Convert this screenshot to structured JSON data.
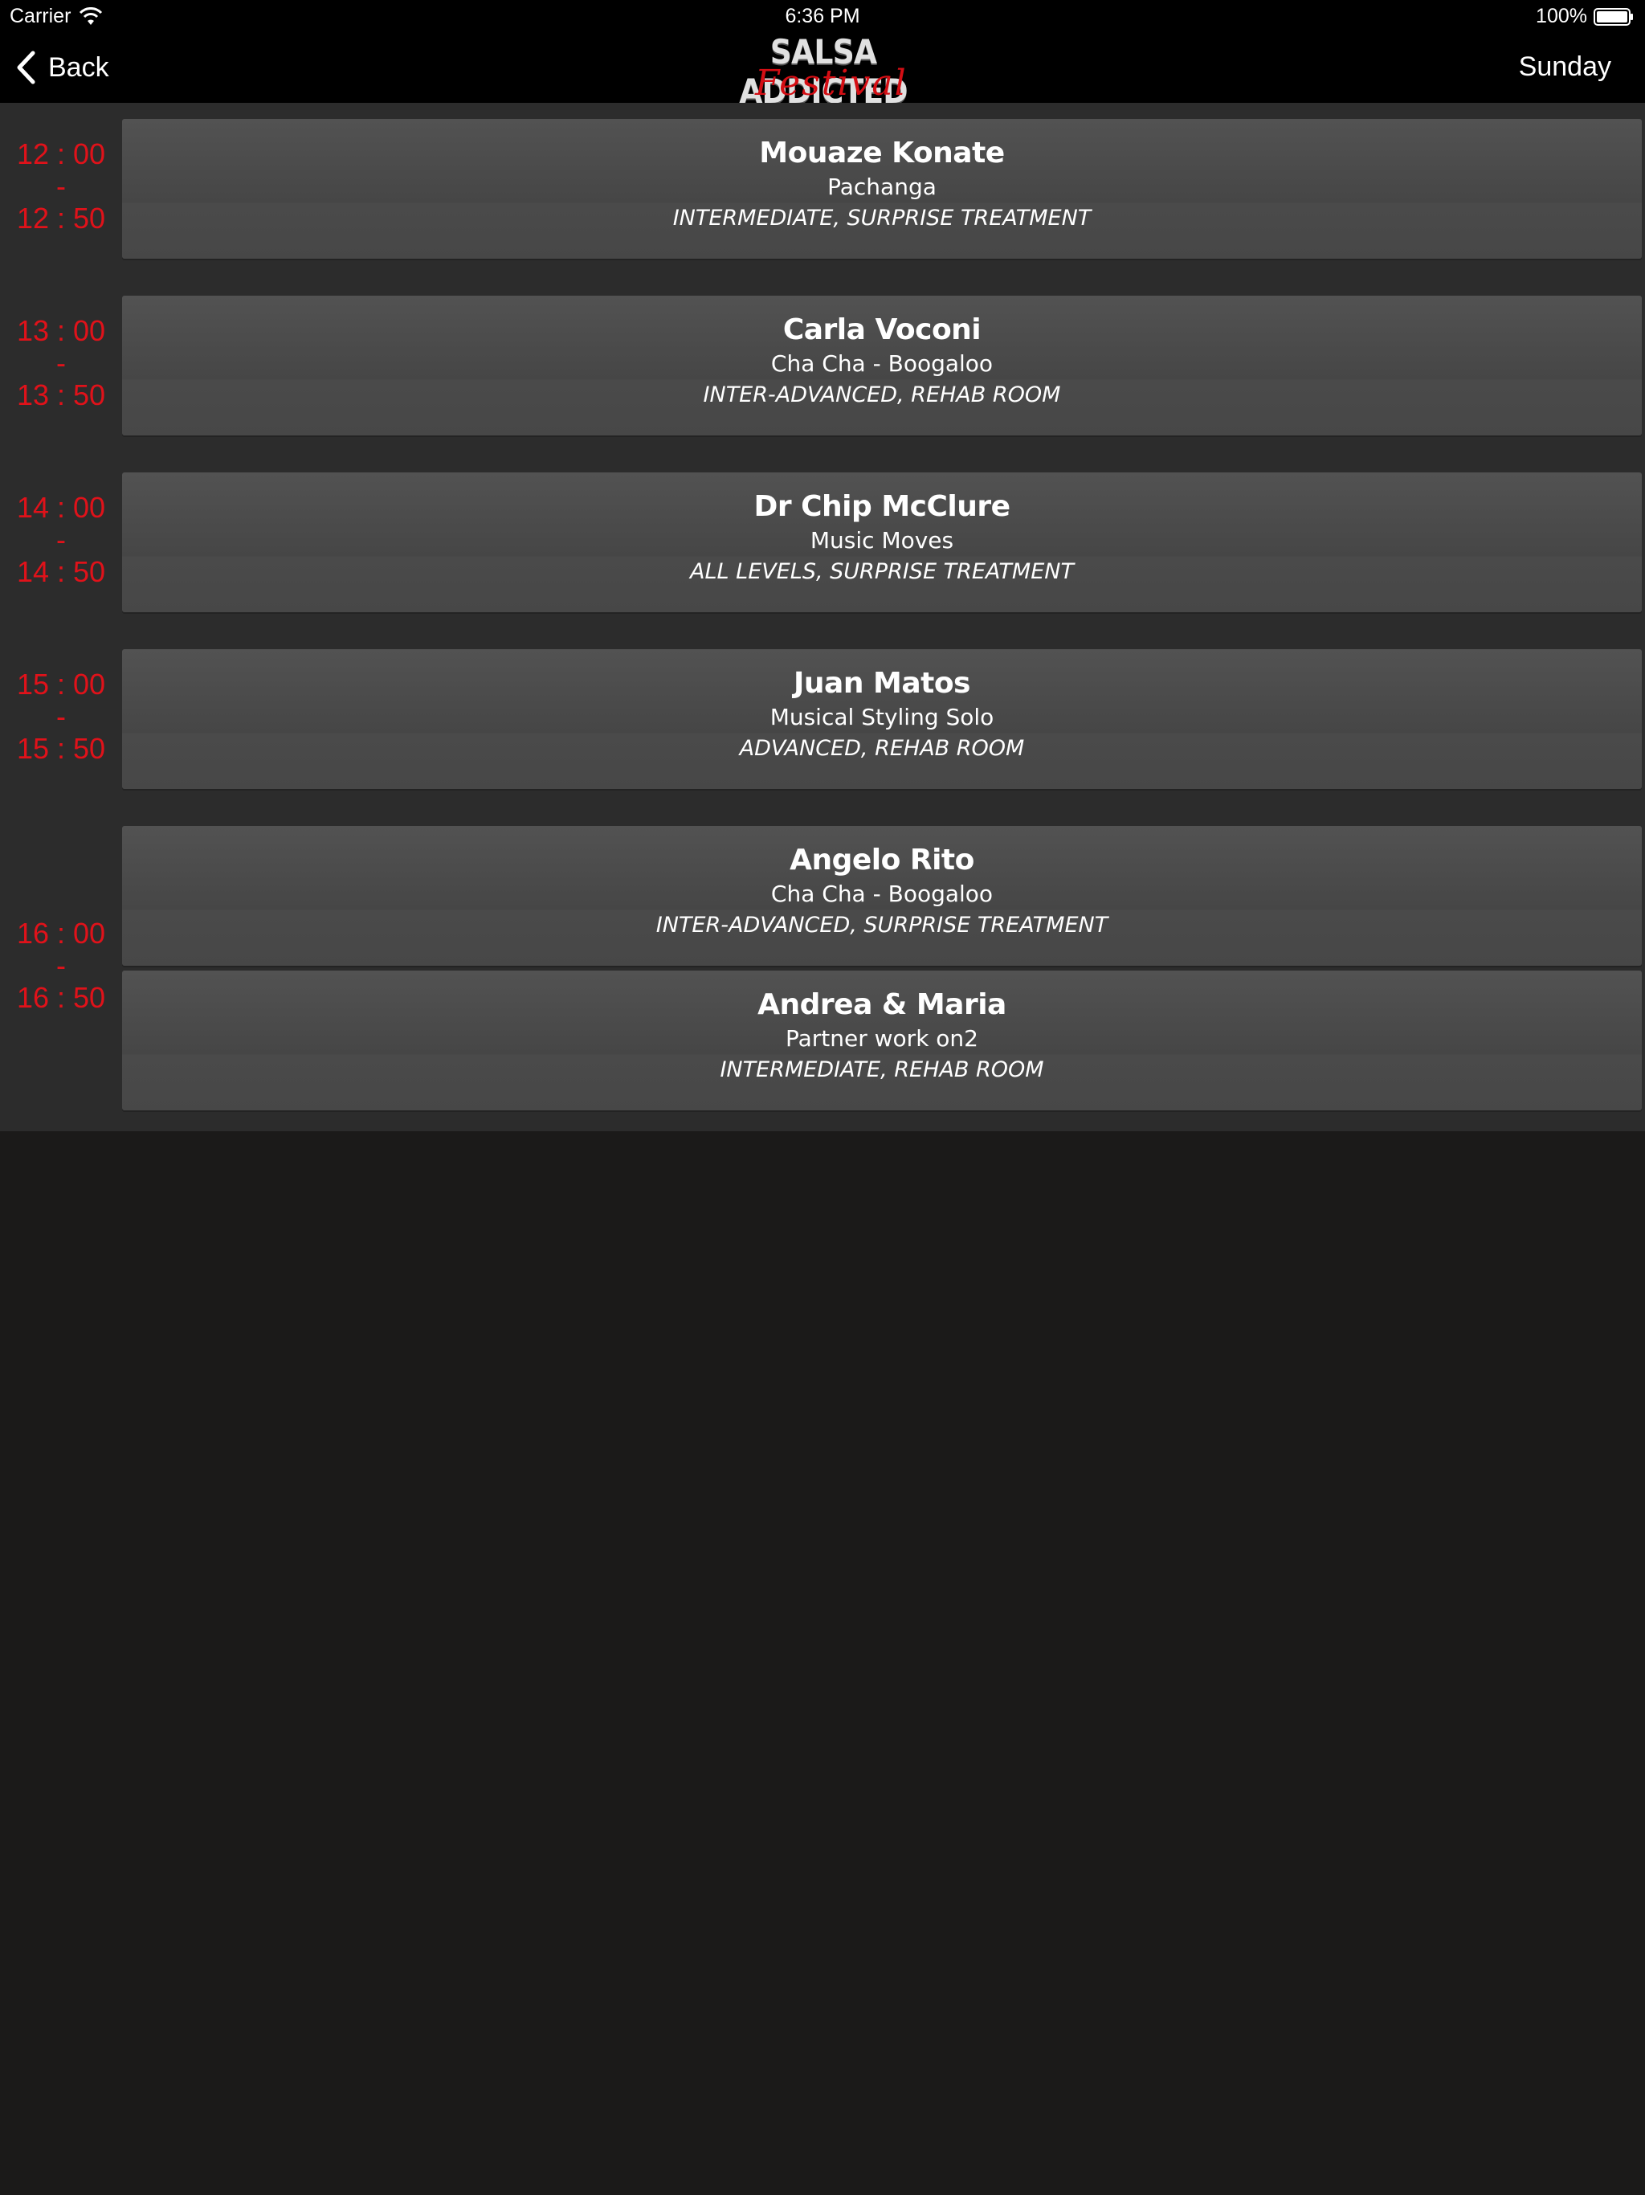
{
  "status_bar": {
    "carrier": "Carrier",
    "time": "6:36 PM",
    "battery": "100%"
  },
  "nav": {
    "back_label": "Back",
    "logo_title": "SALSA ADDICTED",
    "logo_script": "Festival",
    "day": "Sunday"
  },
  "colors": {
    "time_red": "#e0121a",
    "logo_red": "#d40e14",
    "card_bg": "#4c4c4c",
    "list_bg": "#2c2c2c",
    "page_bg": "#1b1a19"
  },
  "slots": [
    {
      "start": "12 : 00",
      "sep": "-",
      "end": "12 : 50"
    },
    {
      "start": "13 : 00",
      "sep": "-",
      "end": "13 : 50"
    },
    {
      "start": "14 : 00",
      "sep": "-",
      "end": "14 : 50"
    },
    {
      "start": "15 : 00",
      "sep": "-",
      "end": "15 : 50"
    },
    {
      "start": "16 : 00",
      "sep": "-",
      "end": "16 : 50"
    }
  ],
  "classes": [
    {
      "name": "Mouaze Konate",
      "style": "Pachanga",
      "level": "INTERMEDIATE, SURPRISE TREATMENT"
    },
    {
      "name": "Carla Voconi",
      "style": "Cha Cha - Boogaloo",
      "level": "INTER-ADVANCED, REHAB ROOM"
    },
    {
      "name": "Dr Chip McClure",
      "style": "Music Moves",
      "level": "ALL LEVELS, SURPRISE TREATMENT"
    },
    {
      "name": "Juan Matos",
      "style": "Musical Styling Solo",
      "level": "ADVANCED, REHAB ROOM"
    },
    {
      "name": "Angelo Rito",
      "style": "Cha Cha - Boogaloo",
      "level": "INTER-ADVANCED, SURPRISE TREATMENT"
    },
    {
      "name": "Andrea & Maria",
      "style": "Partner work on2",
      "level": "INTERMEDIATE, REHAB ROOM"
    }
  ]
}
